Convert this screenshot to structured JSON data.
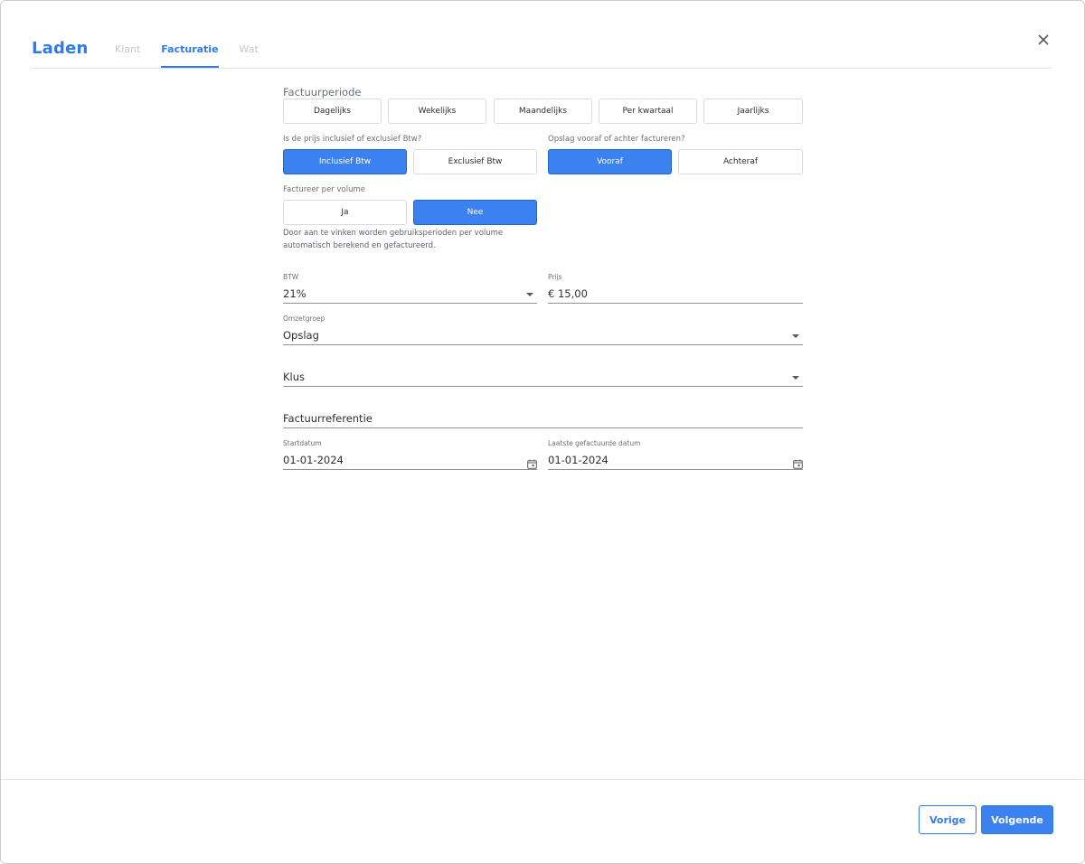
{
  "header": {
    "title": "Laden",
    "tabs": [
      {
        "label": "Klant"
      },
      {
        "label": "Facturatie"
      },
      {
        "label": "Wat"
      }
    ]
  },
  "period": {
    "label": "Factuurperiode",
    "options": [
      "Dagelijks",
      "Wekelijks",
      "Maandelijks",
      "Per kwartaal",
      "Jaarlijks"
    ]
  },
  "vat_mode": {
    "label": "Is de prijs inclusief of exclusief Btw?",
    "options": [
      "Inclusief Btw",
      "Exclusief Btw"
    ],
    "selected": "Inclusief Btw"
  },
  "billing_time": {
    "label": "Opslag vooraf of achter factureren?",
    "options": [
      "Vooraf",
      "Achteraf"
    ],
    "selected": "Vooraf"
  },
  "volume": {
    "label": "Factureer per volume",
    "options": [
      "Ja",
      "Nee"
    ],
    "selected": "Nee",
    "helper": "Door aan te vinken worden gebruiksperioden per volume automatisch berekend en gefactureerd."
  },
  "fields": {
    "btw_label": "BTW",
    "btw_value": "21%",
    "price_label": "Prijs",
    "price_value": "€ 15,00",
    "revenue_group_label": "Omzetgroep",
    "revenue_group_value": "Opslag",
    "job_value": "Klus",
    "invoice_ref_value": "Factuurreferentie",
    "start_date_label": "Startdatum",
    "start_date_value": "01-01-2024",
    "last_invoiced_label": "Laatste gefactuurde datum",
    "last_invoiced_value": "01-01-2024"
  },
  "footer": {
    "prev_label": "Vorige",
    "next_label": "Volgende"
  },
  "colors": {
    "accent": "#3b82f0",
    "tab_inactive": "#c4c8ce"
  }
}
